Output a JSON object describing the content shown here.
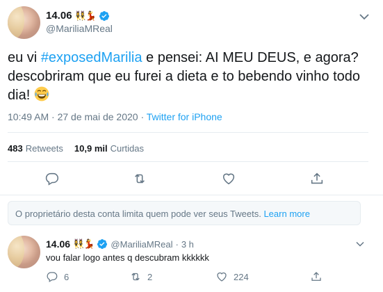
{
  "tweet": {
    "display_name": "14.06",
    "name_emojis": "👯‍♀️💃",
    "handle": "@MariliaMReal",
    "text_before": "eu vi ",
    "hashtag": "#exposedMarilia",
    "text_after": " e pensei: AI MEU DEUS, e agora? descobriram que eu furei a dieta e to bebendo vinho todo dia!",
    "time": "10:49 AM · 27 de mai de 2020 · ",
    "source": "Twitter for iPhone",
    "retweets_count": "483",
    "retweets_label": "Retweets",
    "likes_count": "10,9 mil",
    "likes_label": "Curtidas"
  },
  "notice": {
    "text": "O proprietário desta conta limita quem pode ver seus Tweets. ",
    "link": "Learn more"
  },
  "reply": {
    "display_name": "14.06",
    "name_emojis": "👯‍♀️💃",
    "handle": "@MariliaMReal",
    "dot": "·",
    "time": "3 h",
    "text": "vou falar logo antes q descubram kkkkkk",
    "reply_count": "6",
    "retweet_count": "2",
    "like_count": "224"
  },
  "icons": {
    "verified": "verified-badge-icon",
    "caret": "chevron-down-icon",
    "reply": "reply-icon",
    "retweet": "retweet-icon",
    "like": "heart-icon",
    "share": "share-icon"
  },
  "colors": {
    "accent": "#1da1f2",
    "muted": "#657786",
    "text": "#14171a",
    "border": "#e6ecf0"
  }
}
